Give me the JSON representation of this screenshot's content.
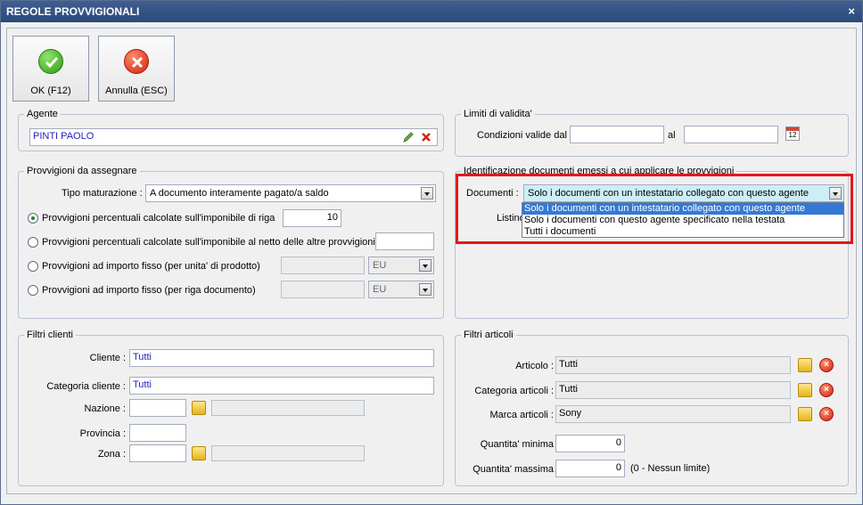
{
  "window": {
    "title": "REGOLE PROVVIGIONALI",
    "close_glyph": "×"
  },
  "toolbar": {
    "ok_label": "OK (F12)",
    "cancel_label": "Annulla (ESC)"
  },
  "agente": {
    "group_title": "Agente",
    "value": "PINTI PAOLO"
  },
  "limiti": {
    "group_title": "Limiti di validita'",
    "label_from": "Condizioni valide dal",
    "label_to": "al",
    "from": "",
    "to": "",
    "calendar_text": "12"
  },
  "provvigioni": {
    "group_title": "Provvigioni da assegnare",
    "tipo_label": "Tipo maturazione :",
    "tipo_value": "A documento interamente pagato/a saldo",
    "options": [
      {
        "label": "Provvigioni percentuali calcolate sull'imponibile di riga",
        "value": "10",
        "selected": true
      },
      {
        "label": "Provvigioni percentuali calcolate sull'imponibile al netto delle altre provvigioni",
        "value": "",
        "selected": false
      },
      {
        "label": "Provvigioni ad importo fisso (per unita' di prodotto)",
        "value": "",
        "unit": "EU",
        "selected": false
      },
      {
        "label": "Provvigioni ad importo fisso (per riga documento)",
        "value": "",
        "unit": "EU",
        "selected": false
      }
    ]
  },
  "identificazione": {
    "group_title": "Identificazione documenti emessi a cui applicare le provvigioni",
    "documenti_label": "Documenti :",
    "documenti_value": "Solo i documenti con un intestatario collegato con questo agente",
    "listino_label": "Listino :",
    "dropdown_options": [
      "Solo i documenti con un intestatario collegato con questo agente",
      "Solo i documenti con questo agente specificato nella testata",
      "Tutti i documenti"
    ]
  },
  "filtri_clienti": {
    "group_title": "Filtri clienti",
    "cliente_label": "Cliente :",
    "cliente_value": "Tutti",
    "categoria_label": "Categoria cliente :",
    "categoria_value": "Tutti",
    "nazione_label": "Nazione :",
    "provincia_label": "Provincia :",
    "zona_label": "Zona :"
  },
  "filtri_articoli": {
    "group_title": "Filtri articoli",
    "articolo_label": "Articolo :",
    "articolo_value": "Tutti",
    "categoria_label": "Categoria articoli :",
    "categoria_value": "Tutti",
    "marca_label": "Marca articoli :",
    "marca_value": "Sony",
    "qmin_label": "Quantita' minima",
    "qmin_value": "0",
    "qmax_label": "Quantita' massima",
    "qmax_value": "0",
    "qmax_note": "(0 - Nessun limite)"
  }
}
